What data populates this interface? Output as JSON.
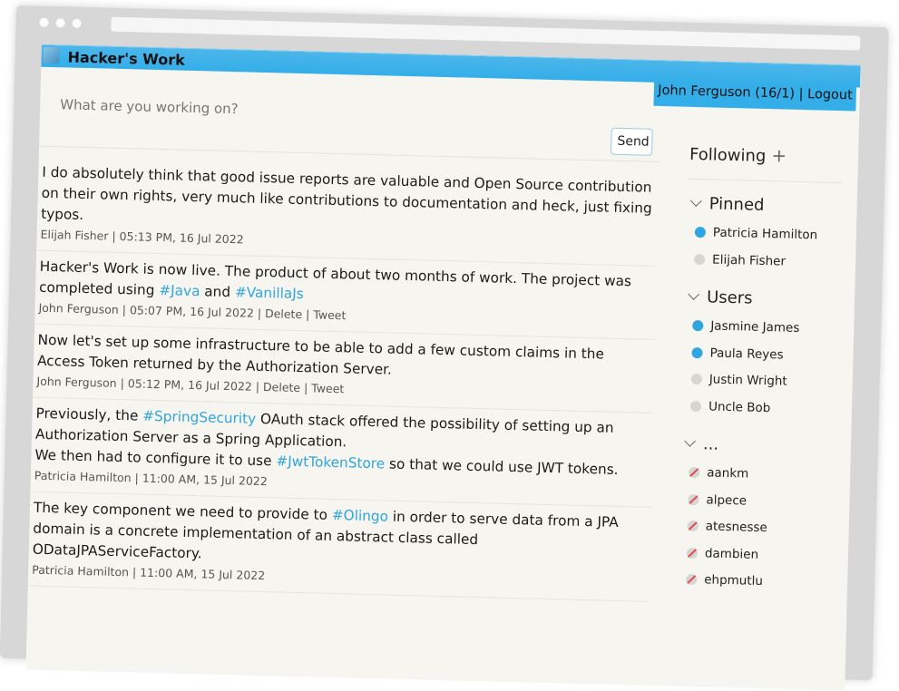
{
  "app": {
    "title": "Hacker's Work"
  },
  "user_nav": {
    "user": "John Ferguson (16/1)",
    "separator": "|",
    "logout": "Logout"
  },
  "compose": {
    "placeholder": "What are you working on?",
    "send_label": "Send"
  },
  "posts": [
    {
      "parts": [
        {
          "t": "I do absolutely think that good issue reports are valuable and Open Source contribution on their own rights, very much like contributions to documentation and heck, just fixing typos."
        }
      ],
      "author": "Elijah Fisher",
      "time": "05:13 PM, 16 Jul 2022",
      "actions": []
    },
    {
      "parts": [
        {
          "t": "Hacker's Work is now live. The product of about two months of work. The project was completed using "
        },
        {
          "tag": "#Java"
        },
        {
          "t": " and "
        },
        {
          "tag": "#VanillaJs"
        }
      ],
      "author": "John Ferguson",
      "time": "05:07 PM, 16 Jul 2022",
      "actions": [
        "Delete",
        "Tweet"
      ]
    },
    {
      "parts": [
        {
          "t": "Now let's set up some infrastructure to be able to add a few custom claims in the Access Token returned by the Authorization Server."
        }
      ],
      "author": "John Ferguson",
      "time": "05:12 PM, 16 Jul 2022",
      "actions": [
        "Delete",
        "Tweet"
      ]
    },
    {
      "parts": [
        {
          "t": "Previously, the "
        },
        {
          "tag": "#SpringSecurity"
        },
        {
          "t": " OAuth stack offered the possibility of setting up an Authorization Server as a Spring Application.\nWe then had to configure it to use "
        },
        {
          "tag": "#JwtTokenStore"
        },
        {
          "t": " so that we could use JWT tokens."
        }
      ],
      "author": "Patricia Hamilton",
      "time": "11:00 AM, 15 Jul 2022",
      "actions": []
    },
    {
      "parts": [
        {
          "t": "The key component we need to provide to "
        },
        {
          "tag": "#Olingo"
        },
        {
          "t": " in order to serve data from a JPA domain is a concrete implementation of an abstract class called ODataJPAServiceFactory."
        }
      ],
      "author": "Patricia Hamilton",
      "time": "11:00 AM, 15 Jul 2022",
      "actions": []
    }
  ],
  "sidebar": {
    "following_label": "Following",
    "add_icon": "plus-icon",
    "groups": [
      {
        "title": "Pinned",
        "items": [
          {
            "name": "Patricia Hamilton",
            "status": "online"
          },
          {
            "name": "Elijah Fisher",
            "status": "offline"
          }
        ]
      },
      {
        "title": "Users",
        "items": [
          {
            "name": "Jasmine James",
            "status": "online"
          },
          {
            "name": "Paula Reyes",
            "status": "online"
          },
          {
            "name": "Justin Wright",
            "status": "offline"
          },
          {
            "name": "Uncle Bob",
            "status": "offline"
          }
        ]
      },
      {
        "title": "...",
        "items": [
          {
            "name": "aankm",
            "status": "banned"
          },
          {
            "name": "alpece",
            "status": "banned"
          },
          {
            "name": "atesnesse",
            "status": "banned"
          },
          {
            "name": "dambien",
            "status": "banned"
          },
          {
            "name": "ehpmutlu",
            "status": "banned"
          }
        ]
      }
    ]
  },
  "colors": {
    "accent": "#34aee9",
    "background": "#f6f5ef",
    "hashtag": "#2fa6df",
    "online": "#2fa6df",
    "offline": "#d5d5d2",
    "banned": "#e04b4b"
  }
}
